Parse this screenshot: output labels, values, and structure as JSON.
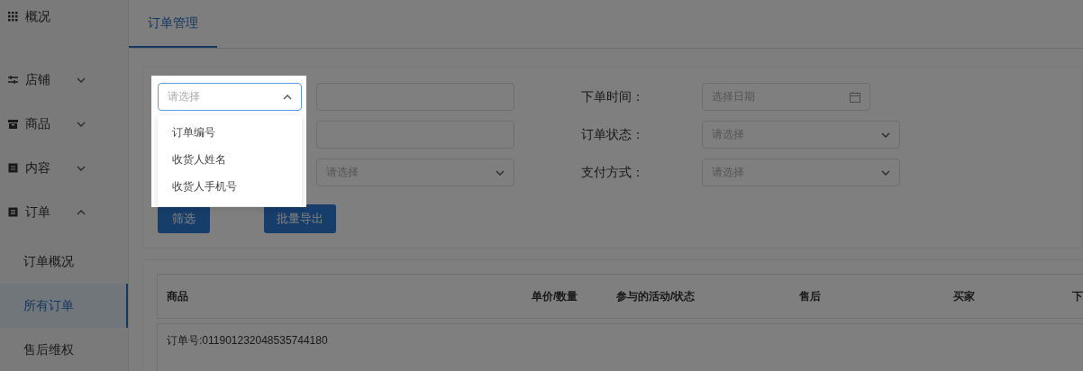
{
  "sidebar": {
    "items": [
      {
        "label": "概况",
        "kind": "link"
      },
      {
        "label": "店铺",
        "kind": "group",
        "expanded": false
      },
      {
        "label": "商品",
        "kind": "group",
        "expanded": false
      },
      {
        "label": "内容",
        "kind": "group",
        "expanded": false
      },
      {
        "label": "订单",
        "kind": "group",
        "expanded": true,
        "children": [
          {
            "label": "订单概况",
            "selected": false
          },
          {
            "label": "所有订单",
            "selected": true
          },
          {
            "label": "售后维权",
            "selected": false
          }
        ]
      }
    ]
  },
  "tabs": [
    {
      "label": "订单管理",
      "selected": true
    }
  ],
  "filters": {
    "search_type": {
      "placeholder": "请选择",
      "open": true,
      "options": [
        {
          "label": "订单编号"
        },
        {
          "label": "收货人姓名"
        },
        {
          "label": "收货人手机号"
        }
      ]
    },
    "left_fields": [
      {
        "kind": "input"
      },
      {
        "kind": "input"
      },
      {
        "kind": "select",
        "placeholder": "请选择"
      }
    ],
    "right_fields": [
      {
        "label": "下单时间：",
        "kind": "date",
        "placeholder": "选择日期"
      },
      {
        "label": "订单状态：",
        "kind": "select",
        "placeholder": "请选择"
      },
      {
        "label": "支付方式：",
        "kind": "select",
        "placeholder": "请选择"
      }
    ],
    "buttons": [
      "筛选",
      "批量导出"
    ]
  },
  "table": {
    "columns": [
      "商品",
      "单价/数量",
      "参与的活动/状态",
      "售后",
      "买家",
      "下"
    ],
    "orders": [
      {
        "order_no": "订单号:011901232048535744180"
      }
    ]
  }
}
